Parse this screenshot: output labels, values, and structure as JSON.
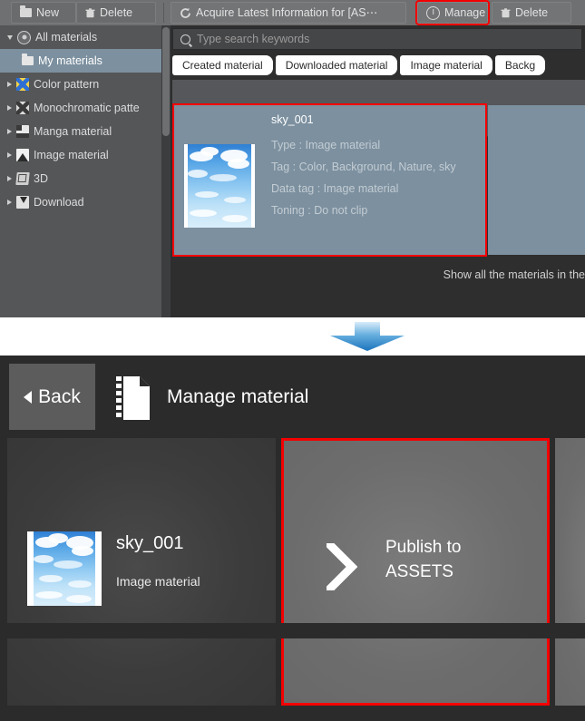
{
  "top_panel": {
    "toolbar": {
      "new_label": "New",
      "delete_label": "Delete",
      "acquire_label": "Acquire Latest Information for [AS⋯",
      "manage_label": "Manage",
      "delete2_label": "Delete",
      "highlight_color": "#f40000"
    },
    "tree": {
      "items": [
        {
          "label": "All materials",
          "icon": "disc-icon",
          "level": 1,
          "expanded": true,
          "selected": false
        },
        {
          "label": "My materials",
          "icon": "folder-icon",
          "level": 2,
          "expanded": null,
          "selected": true
        },
        {
          "label": "Color pattern",
          "icon": "color-pattern-icon",
          "level": 1,
          "expanded": false,
          "selected": false
        },
        {
          "label": "Monochromatic patte",
          "icon": "mono-pattern-icon",
          "level": 1,
          "expanded": false,
          "selected": false
        },
        {
          "label": "Manga material",
          "icon": "manga-icon",
          "level": 1,
          "expanded": false,
          "selected": false
        },
        {
          "label": "Image material",
          "icon": "image-icon",
          "level": 1,
          "expanded": false,
          "selected": false
        },
        {
          "label": "3D",
          "icon": "cube-icon",
          "level": 1,
          "expanded": false,
          "selected": false
        },
        {
          "label": "Download",
          "icon": "download-icon",
          "level": 1,
          "expanded": false,
          "selected": false
        }
      ]
    },
    "search": {
      "placeholder": "Type search keywords",
      "value": ""
    },
    "tabs": [
      {
        "label": "Created material"
      },
      {
        "label": "Downloaded material"
      },
      {
        "label": "Image material"
      },
      {
        "label": "Backg"
      }
    ],
    "material": {
      "name": "sky_001",
      "type_line": "Type : Image material",
      "tag_line": "Tag : Color, Background, Nature, sky",
      "data_tag_line": "Data tag : Image material",
      "toning_line": "Toning : Do not clip",
      "selected_color": "#7c909f"
    },
    "show_all_label": "Show all the materials in the"
  },
  "bottom_panel": {
    "back_label": "Back",
    "title": "Manage material",
    "cards": [
      {
        "name": "sky_001",
        "subtitle": "Image material",
        "kind": "material"
      },
      {
        "name": "Publish to ASSETS",
        "kind": "action"
      }
    ]
  }
}
